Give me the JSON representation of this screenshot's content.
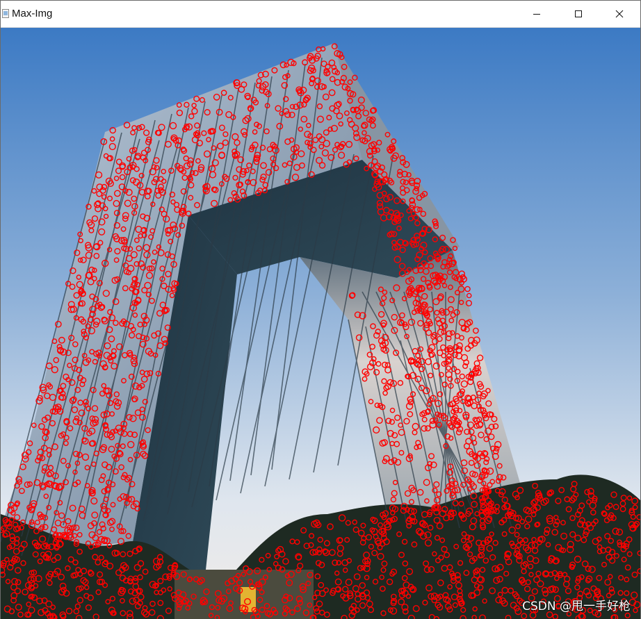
{
  "window": {
    "title": "Max-Img",
    "icon": "image-icon",
    "controls": {
      "minimize": "minimize-icon",
      "maximize": "maximize-icon",
      "close": "close-icon"
    }
  },
  "image": {
    "description_color_sky_top": "#3e7fc7",
    "description_color_sky_bottom": "#eef2f6",
    "marker_color": "#ff0000",
    "watermark": "CSDN @甩一手好枪"
  }
}
